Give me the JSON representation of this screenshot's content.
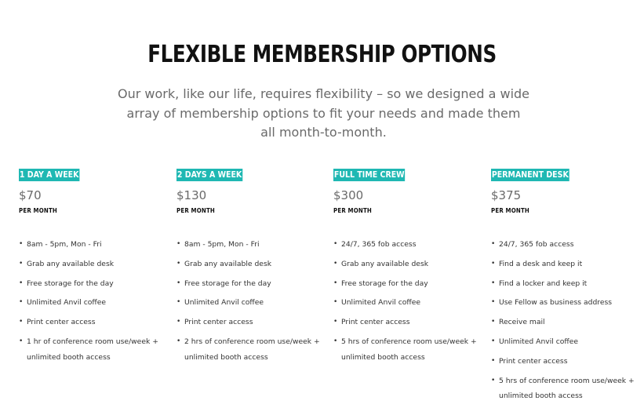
{
  "header": {
    "title": "FLEXIBLE MEMBERSHIP OPTIONS",
    "subtitle": "Our work, like our life, requires flexibility – so we designed a wide array of membership options to fit your needs and made them all month-to-month."
  },
  "colors": {
    "accent": "#1fb8b3",
    "title": "#111111",
    "muted": "#6a6a6a"
  },
  "plans": [
    {
      "name": "1 DAY A WEEK",
      "price": "$70",
      "period": "PER MONTH",
      "features": [
        "8am - 5pm, Mon - Fri",
        "Grab any available desk",
        "Free storage for the day",
        "Unlimited Anvil coffee",
        "Print center access",
        "1 hr of conference room use/week + unlimited booth access"
      ]
    },
    {
      "name": "2 DAYS A WEEK",
      "price": "$130",
      "period": "PER MONTH",
      "features": [
        "8am - 5pm, Mon - Fri",
        "Grab any available desk",
        "Free storage for the day",
        "Unlimited Anvil coffee",
        "Print center access",
        "2 hrs of conference room use/week + unlimited booth access"
      ]
    },
    {
      "name": "FULL TIME CREW",
      "price": "$300",
      "period": "PER MONTH",
      "features": [
        "24/7, 365 fob access",
        "Grab any available desk",
        "Free storage for the day",
        "Unlimited Anvil coffee",
        "Print center access",
        "5 hrs of conference room use/week + unlimited booth access"
      ]
    },
    {
      "name": "PERMANENT DESK",
      "price": "$375",
      "period": "PER MONTH",
      "features": [
        "24/7, 365 fob access",
        "Find a desk and keep it",
        "Find a locker and keep it",
        "Use Fellow as business address",
        "Receive mail",
        "Unlimited Anvil coffee",
        "Print center access",
        "5 hrs of conference room use/week + unlimited booth access"
      ]
    }
  ]
}
